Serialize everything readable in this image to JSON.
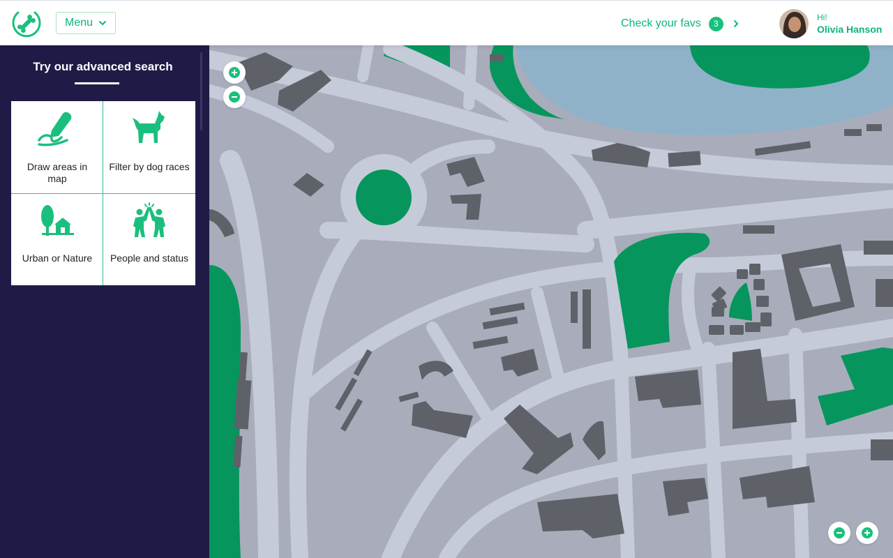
{
  "colors": {
    "accent": "#1bbf7d",
    "sidebar_bg": "#201b46",
    "map_park": "#06965d",
    "map_water": "#8fb2c9"
  },
  "header": {
    "menu_label": "Menu",
    "favs_label": "Check your favs",
    "favs_count": "3",
    "greeting": "Hi!",
    "user_name": "Olivia Hanson"
  },
  "sidebar": {
    "title": "Try our advanced search",
    "options": [
      {
        "label": "Draw areas in map",
        "icon": "draw-pen-icon"
      },
      {
        "label": "Filter by dog races",
        "icon": "dog-icon"
      },
      {
        "label": "Urban or Nature",
        "icon": "tree-house-icon"
      },
      {
        "label": "People and status",
        "icon": "people-high-five-icon"
      }
    ]
  },
  "map": {
    "controls": [
      "zoom-in",
      "zoom-out"
    ]
  }
}
